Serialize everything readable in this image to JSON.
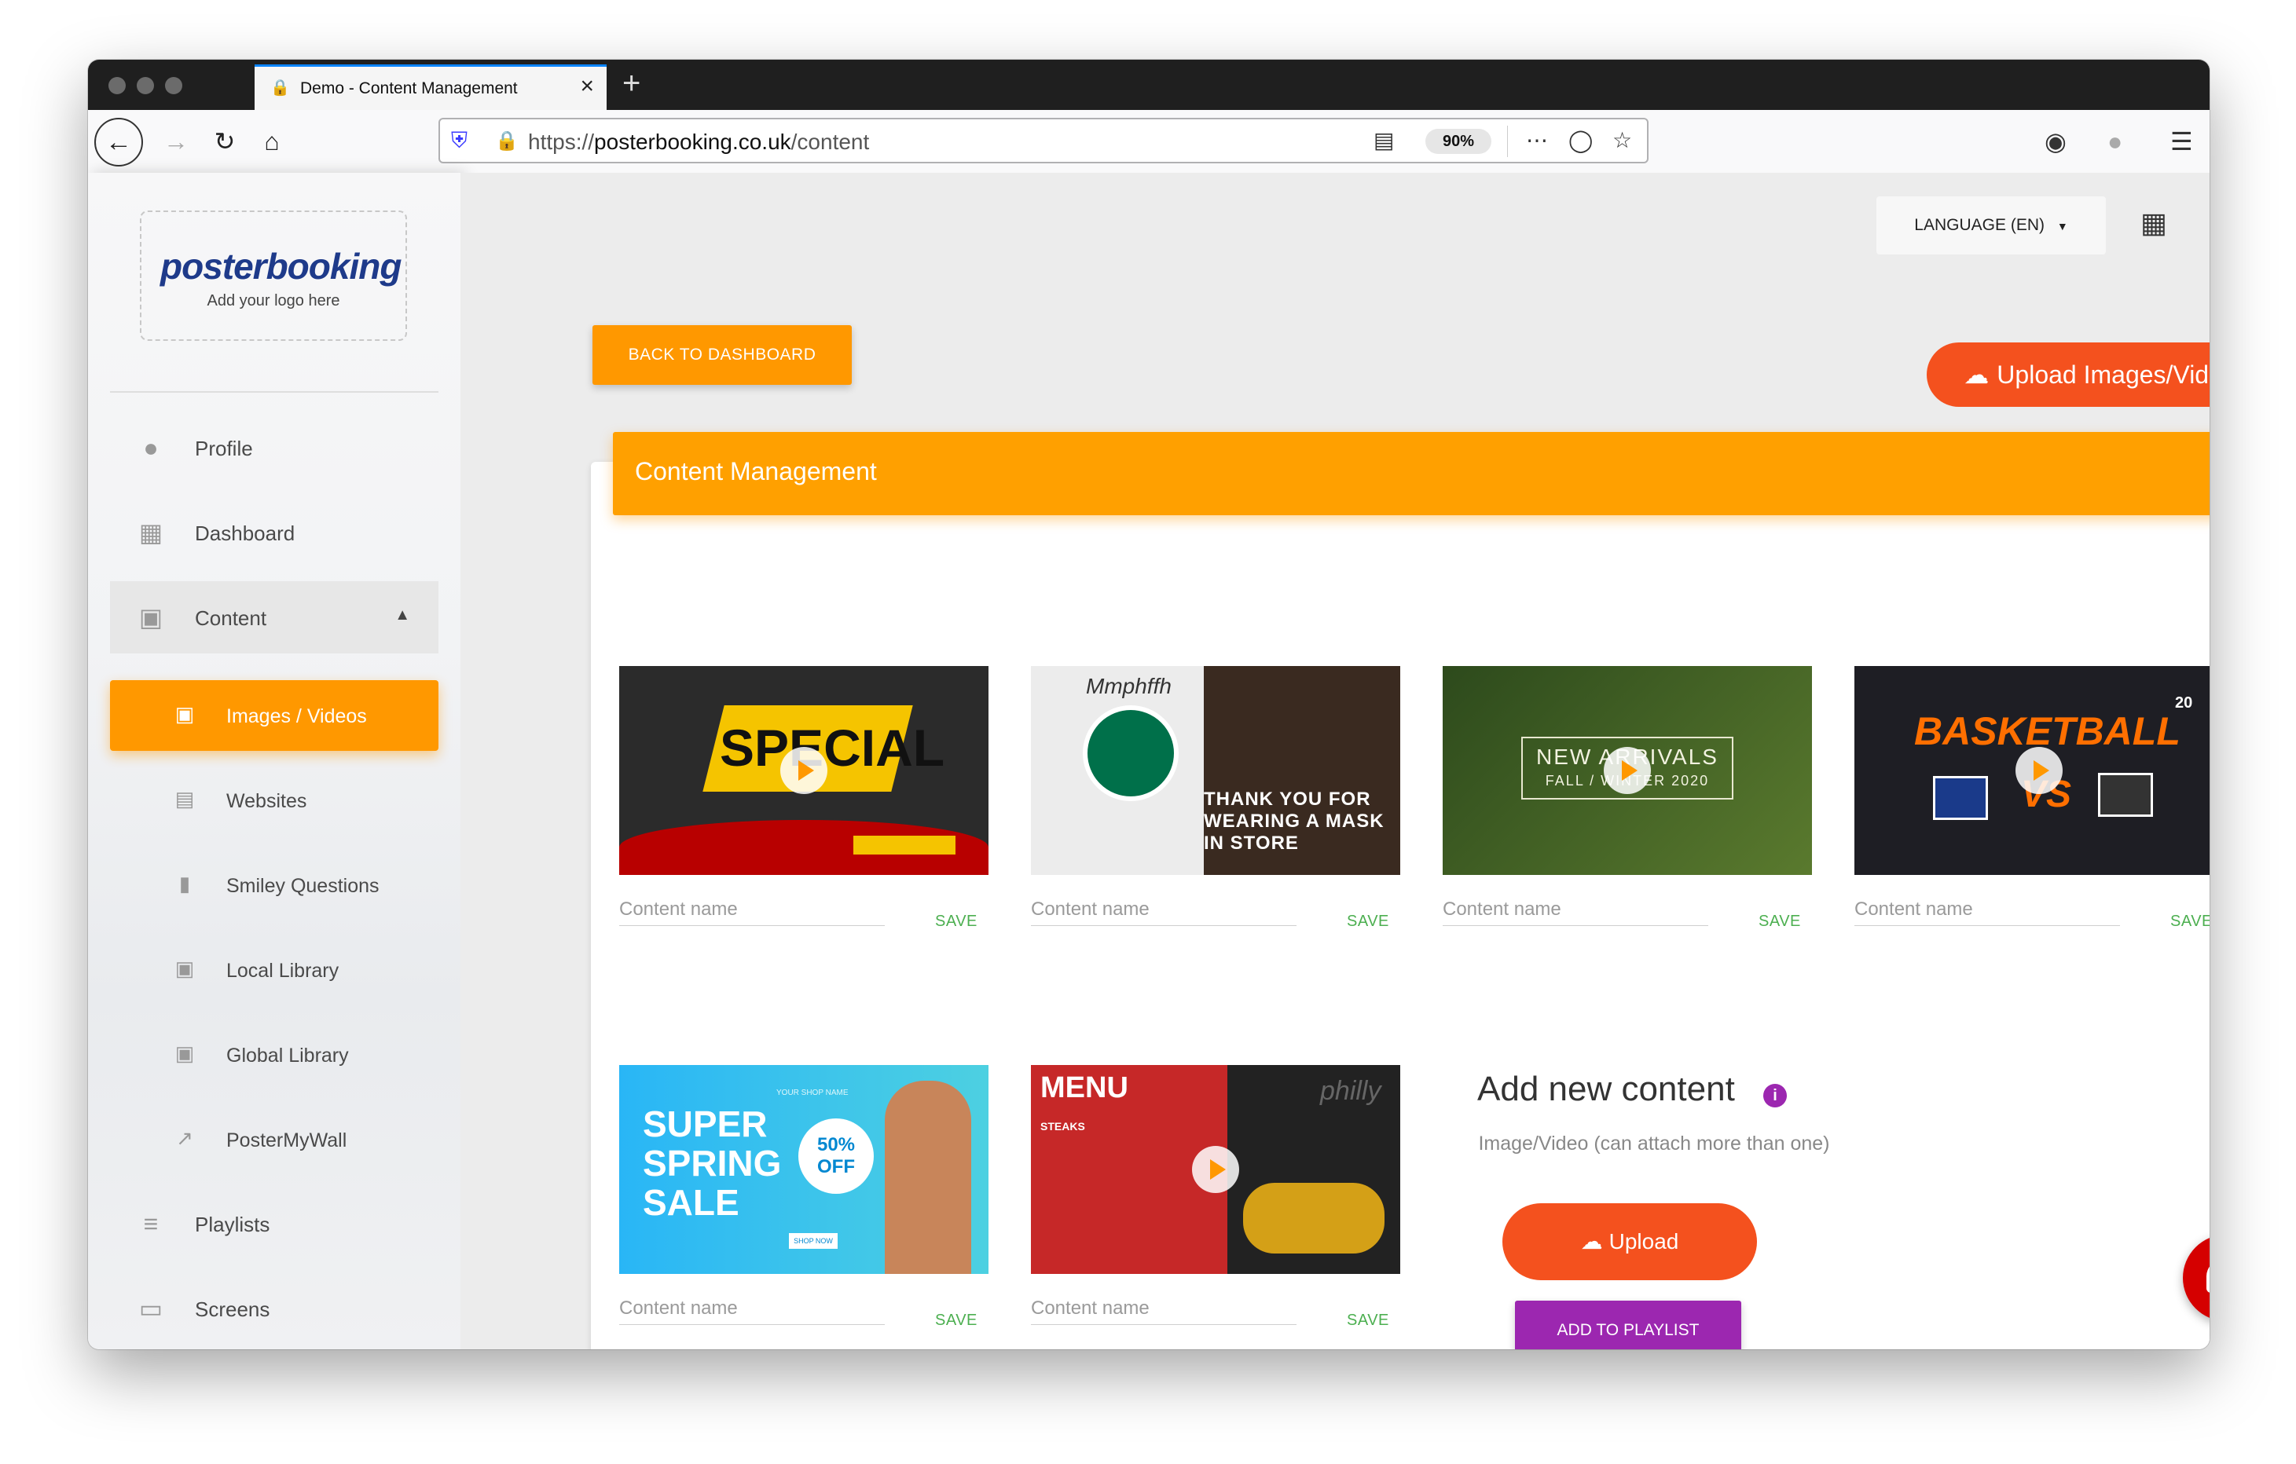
{
  "browser": {
    "tab_title": "Demo - Content Management",
    "url_prefix": "https://",
    "url_host": "posterbooking.co.uk",
    "url_path": "/content",
    "zoom": "90%"
  },
  "sidebar": {
    "logo": "posterbooking",
    "logo_sub": "Add your logo here",
    "items": [
      {
        "label": "Profile",
        "icon": "person-icon"
      },
      {
        "label": "Dashboard",
        "icon": "dashboard-icon"
      },
      {
        "label": "Content",
        "icon": "image-icon"
      }
    ],
    "subitems": [
      {
        "label": "Images / Videos",
        "icon": "image-icon"
      },
      {
        "label": "Websites",
        "icon": "web-icon"
      },
      {
        "label": "Smiley Questions",
        "icon": "chat-icon"
      },
      {
        "label": "Local Library",
        "icon": "image-icon"
      },
      {
        "label": "Global Library",
        "icon": "image-icon"
      },
      {
        "label": "PosterMyWall",
        "icon": "external-link-icon"
      }
    ],
    "bottom_items": [
      {
        "label": "Playlists",
        "icon": "playlist-add-icon"
      },
      {
        "label": "Screens",
        "icon": "devices-icon"
      }
    ]
  },
  "header": {
    "language": "LANGUAGE (EN)"
  },
  "main": {
    "back_button": "BACK TO DASHBOARD",
    "upload_top": "Upload Images/Video",
    "card_title": "Content Management",
    "content_placeholder": "Content name",
    "save_label": "SAVE",
    "thumbs": [
      {
        "text": "SPECIAL"
      },
      {
        "text": "THANK YOU FOR WEARING A MASK IN STORE",
        "text2": "Mmphffh"
      },
      {
        "text": "NEW ARRIVALS",
        "text2": "FALL / WINTER 2020"
      },
      {
        "text": "BASKETBALL",
        "text2": "VS",
        "text3": "20"
      },
      {
        "text": "SUPER SPRING SALE",
        "text2": "50% OFF",
        "text3": "YOUR SHOP NAME",
        "text4": "SHOP NOW"
      },
      {
        "text": "MENU",
        "text2": "STEAKS",
        "text3": "philly"
      }
    ],
    "add_title": "Add new content",
    "add_sub": "Image/Video (can attach more than one)",
    "upload_label": "Upload",
    "playlist_label": "ADD TO PLAYLIST"
  }
}
